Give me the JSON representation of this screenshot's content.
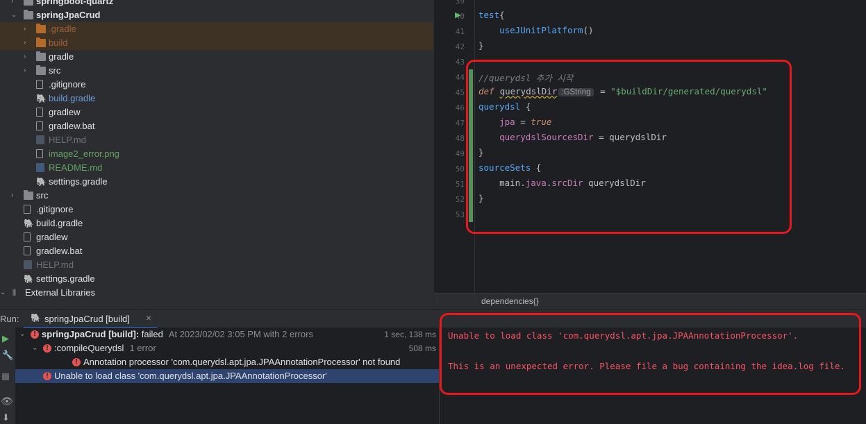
{
  "project_tree": [
    {
      "label": "springboot-quartz",
      "depth": 1,
      "chevron": "›",
      "icon": "folder",
      "style": "bold"
    },
    {
      "label": "springJpaCrud",
      "depth": 1,
      "chevron": "⌄",
      "icon": "folder",
      "style": "bold"
    },
    {
      "label": ".gradle",
      "depth": 2,
      "chevron": "›",
      "icon": "folder-orange",
      "style": "orange",
      "excluded": true
    },
    {
      "label": "build",
      "depth": 2,
      "chevron": "›",
      "icon": "folder-orange",
      "style": "orange",
      "excluded": true
    },
    {
      "label": "gradle",
      "depth": 2,
      "chevron": "›",
      "icon": "folder",
      "style": "default"
    },
    {
      "label": "src",
      "depth": 2,
      "chevron": "›",
      "icon": "folder",
      "style": "default"
    },
    {
      "label": ".gitignore",
      "depth": 2,
      "chevron": "",
      "icon": "file",
      "style": "default"
    },
    {
      "label": "build.gradle",
      "depth": 2,
      "chevron": "",
      "icon": "gradle",
      "style": "blue"
    },
    {
      "label": "gradlew",
      "depth": 2,
      "chevron": "",
      "icon": "file",
      "style": "default"
    },
    {
      "label": "gradlew.bat",
      "depth": 2,
      "chevron": "",
      "icon": "file",
      "style": "default"
    },
    {
      "label": "HELP.md",
      "depth": 2,
      "chevron": "",
      "icon": "md-dim",
      "style": "gray"
    },
    {
      "label": "image2_error.png",
      "depth": 2,
      "chevron": "",
      "icon": "file",
      "style": "green"
    },
    {
      "label": "README.md",
      "depth": 2,
      "chevron": "",
      "icon": "md",
      "style": "green"
    },
    {
      "label": "settings.gradle",
      "depth": 2,
      "chevron": "",
      "icon": "gradle",
      "style": "default"
    },
    {
      "label": "src",
      "depth": 1,
      "chevron": "›",
      "icon": "folder",
      "style": "default"
    },
    {
      "label": ".gitignore",
      "depth": 1,
      "chevron": "",
      "icon": "file",
      "style": "default"
    },
    {
      "label": "build.gradle",
      "depth": 1,
      "chevron": "",
      "icon": "gradle",
      "style": "default"
    },
    {
      "label": "gradlew",
      "depth": 1,
      "chevron": "",
      "icon": "file",
      "style": "default"
    },
    {
      "label": "gradlew.bat",
      "depth": 1,
      "chevron": "",
      "icon": "file",
      "style": "default"
    },
    {
      "label": "HELP.md",
      "depth": 1,
      "chevron": "",
      "icon": "md-dim",
      "style": "gray"
    },
    {
      "label": "settings.gradle",
      "depth": 1,
      "chevron": "",
      "icon": "gradle",
      "style": "default"
    },
    {
      "label": "External Libraries",
      "depth": 0,
      "chevron": "⌄",
      "icon": "library",
      "style": "default"
    }
  ],
  "editor": {
    "lines": [
      {
        "n": "39",
        "tokens": []
      },
      {
        "n": "40",
        "tokens": [
          [
            "fn",
            "test"
          ],
          [
            "",
            "{"
          ]
        ]
      },
      {
        "n": "41",
        "tokens": [
          [
            "",
            "    "
          ],
          [
            "fn",
            "useJUnitPlatform"
          ],
          [
            "",
            "()"
          ]
        ]
      },
      {
        "n": "42",
        "tokens": [
          [
            "",
            "}"
          ]
        ]
      },
      {
        "n": "43",
        "tokens": []
      },
      {
        "n": "44",
        "tokens": [
          [
            "cm",
            "//querydsl 추가 시작"
          ]
        ]
      },
      {
        "n": "45",
        "tokens": [
          [
            "kw",
            "def"
          ],
          [
            "",
            ""
          ],
          [
            "squig",
            "querydslDir"
          ],
          [
            "hint",
            ":GString"
          ],
          [
            "",
            " = "
          ],
          [
            "str",
            "\"$buildDir/generated/querydsl\""
          ]
        ]
      },
      {
        "n": "46",
        "tokens": [
          [
            "fn",
            "querydsl"
          ],
          [
            "",
            " {"
          ]
        ]
      },
      {
        "n": "47",
        "tokens": [
          [
            "",
            "    "
          ],
          [
            "pr",
            "jpa"
          ],
          [
            "",
            " = "
          ],
          [
            "kw",
            "true"
          ]
        ]
      },
      {
        "n": "48",
        "tokens": [
          [
            "",
            "    "
          ],
          [
            "pr",
            "querydslSourcesDir"
          ],
          [
            "",
            " = querydslDir"
          ]
        ]
      },
      {
        "n": "49",
        "tokens": [
          [
            "",
            "}"
          ]
        ]
      },
      {
        "n": "50",
        "tokens": [
          [
            "fn",
            "sourceSets"
          ],
          [
            "",
            " {"
          ]
        ]
      },
      {
        "n": "51",
        "tokens": [
          [
            "",
            "    main."
          ],
          [
            "pr",
            "java"
          ],
          [
            "",
            "."
          ],
          [
            "pr",
            "srcDir"
          ],
          [
            "",
            " querydslDir"
          ]
        ]
      },
      {
        "n": "52",
        "tokens": [
          [
            "",
            "}"
          ]
        ]
      },
      {
        "n": "53",
        "tokens": []
      }
    ],
    "breadcrumb": "dependencies{}"
  },
  "run_bar": {
    "prefix": "Run:",
    "tab_label": "springJpaCrud [build]"
  },
  "run_tree": [
    {
      "indent": 0,
      "chev": "⌄",
      "bold": "springJpaCrud [build]:",
      "rest": " failed",
      "meta": "At 2023/02/02 3:05 PM with 2 errors",
      "dur": "1 sec, 138 ms"
    },
    {
      "indent": 1,
      "chev": "⌄",
      "bold": "",
      "rest": ":compileQuerydsl",
      "meta": "1 error",
      "dur": "508 ms"
    },
    {
      "indent": 2,
      "chev": "",
      "bold": "",
      "rest": "Annotation processor 'com.querydsl.apt.jpa.JPAAnnotationProcessor' not found",
      "meta": "",
      "dur": ""
    },
    {
      "indent": 1,
      "chev": "",
      "bold": "",
      "rest": "Unable to load class 'com.querydsl.apt.jpa.JPAAnnotationProcessor'",
      "meta": "",
      "dur": "",
      "selected": true
    }
  ],
  "console": [
    "Unable to load class 'com.querydsl.apt.jpa.JPAAnnotationProcessor'.",
    "",
    "This is an unexpected error. Please file a bug containing the idea.log file."
  ],
  "colors": {
    "error_red": "#f75464",
    "highlight_box": "#e8191c",
    "selection": "#2e436e"
  }
}
